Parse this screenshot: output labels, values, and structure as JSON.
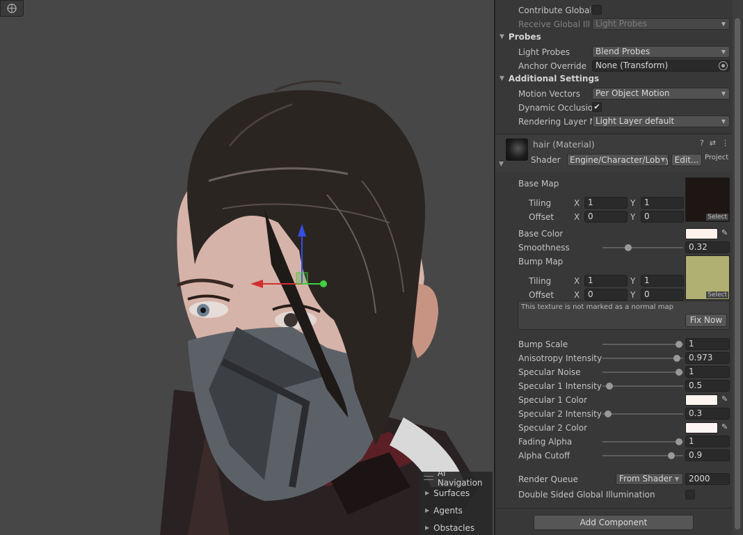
{
  "scene": {
    "ai_navigation": {
      "title": "AI Navigation",
      "items": [
        "Surfaces",
        "Agents",
        "Obstacles"
      ]
    }
  },
  "inspector": {
    "lighting": {
      "contribute_gi_label": "Contribute Global Illumination",
      "receive_gi_label": "Receive Global Illumination",
      "receive_gi_value": "Light Probes"
    },
    "probes": {
      "title": "Probes",
      "light_probes_label": "Light Probes",
      "light_probes_value": "Blend Probes",
      "anchor_override_label": "Anchor Override",
      "anchor_override_value": "None (Transform)"
    },
    "additional": {
      "title": "Additional Settings",
      "motion_vectors_label": "Motion Vectors",
      "motion_vectors_value": "Per Object Motion",
      "dynamic_occlusion_label": "Dynamic Occlusion",
      "dynamic_occlusion_checked": "✔",
      "rendering_layer_label": "Rendering Layer Mask",
      "rendering_layer_value": "Light Layer default"
    },
    "material": {
      "name": "hair (Material)",
      "shader_label": "Shader",
      "shader_value": "Engine/Character/Lobby/Hair",
      "edit_label": "Edit...",
      "project_label": "Project",
      "help_icon": "?",
      "preset_icon": "⇄",
      "menu_icon": "⋮",
      "base_map": {
        "label": "Base Map",
        "tiling_label": "Tiling",
        "offset_label": "Offset",
        "x_label": "X",
        "y_label": "Y",
        "tiling_x": "1",
        "tiling_y": "1",
        "offset_x": "0",
        "offset_y": "0",
        "select_label": "Select"
      },
      "base_color": {
        "label": "Base Color",
        "color": "#fff1ec"
      },
      "smoothness": {
        "label": "Smoothness",
        "value": "0.32",
        "fraction": 0.32
      },
      "bump_map": {
        "label": "Bump Map",
        "tiling_label": "Tiling",
        "offset_label": "Offset",
        "x_label": "X",
        "y_label": "Y",
        "tiling_x": "1",
        "tiling_y": "1",
        "offset_x": "0",
        "offset_y": "0",
        "select_label": "Select",
        "warning": "This texture is not marked as a normal map",
        "fix_label": "Fix Now"
      },
      "sliders": [
        {
          "label": "Bump Scale",
          "value": "1",
          "fraction": 0.95
        },
        {
          "label": "Anisotropy Intensity",
          "value": "0.973",
          "fraction": 0.92
        },
        {
          "label": "Specular Noise",
          "value": "1",
          "fraction": 0.95
        },
        {
          "label": "Specular 1 Intensity",
          "value": "0.5",
          "fraction": 0.09
        }
      ],
      "spec1_color": {
        "label": "Specular 1 Color",
        "color": "#fff5f0"
      },
      "spec2_intensity": {
        "label": "Specular 2 Intensity",
        "value": "0.3",
        "fraction": 0.07
      },
      "spec2_color": {
        "label": "Specular 2 Color",
        "color": "#fff3f3"
      },
      "fading_alpha": {
        "label": "Fading Alpha",
        "value": "1",
        "fraction": 0.95
      },
      "alpha_cutoff": {
        "label": "Alpha Cutoff",
        "value": "0.9",
        "fraction": 0.85
      },
      "render_queue": {
        "label": "Render Queue",
        "mode": "From Shader",
        "value": "2000"
      },
      "double_sided_gi": {
        "label": "Double Sided Global Illumination"
      }
    },
    "add_component_label": "Add Component"
  }
}
